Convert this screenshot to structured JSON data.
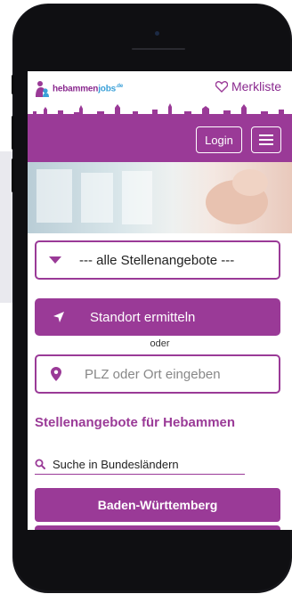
{
  "header": {
    "logo": {
      "part1": "hebammen",
      "part2": "jobs",
      "part3": ".de"
    },
    "merkliste_label": "Merkliste",
    "login_label": "Login"
  },
  "filter": {
    "select_value": "--- alle Stellenangebote ---",
    "locate_label": "Standort ermitteln",
    "or_label": "oder",
    "location_placeholder": "PLZ oder Ort eingeben",
    "location_value": ""
  },
  "content": {
    "section_title": "Stellenangebote für Hebammen",
    "search_label": "Suche in Bundesländern",
    "states": [
      "Baden-Württemberg"
    ]
  },
  "colors": {
    "brand_purple": "#9a3a97",
    "brand_blue": "#3aa0d8",
    "phone_body": "#16161a"
  }
}
